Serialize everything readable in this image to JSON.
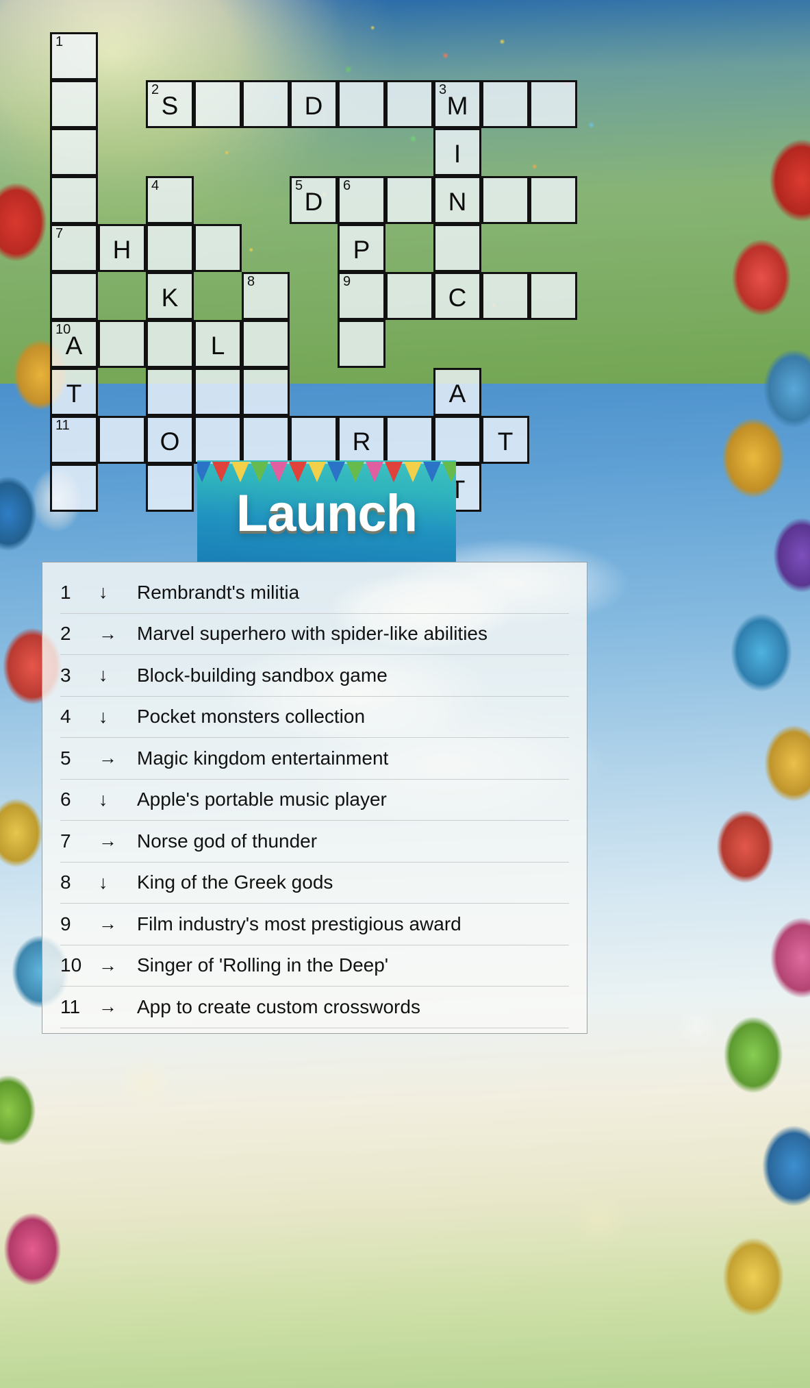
{
  "banner": {
    "title": "Launch"
  },
  "grid": {
    "columns": 12,
    "rows": 10,
    "cell_size": 70,
    "cells": [
      {
        "r": 0,
        "c": 0,
        "num": "1",
        "letter": ""
      },
      {
        "r": 1,
        "c": 0,
        "num": "",
        "letter": ""
      },
      {
        "r": 1,
        "c": 2,
        "num": "2",
        "letter": "S"
      },
      {
        "r": 1,
        "c": 3,
        "num": "",
        "letter": ""
      },
      {
        "r": 1,
        "c": 4,
        "num": "",
        "letter": ""
      },
      {
        "r": 1,
        "c": 5,
        "num": "",
        "letter": "D"
      },
      {
        "r": 1,
        "c": 6,
        "num": "",
        "letter": ""
      },
      {
        "r": 1,
        "c": 7,
        "num": "",
        "letter": ""
      },
      {
        "r": 1,
        "c": 8,
        "num": "3",
        "letter": "M"
      },
      {
        "r": 1,
        "c": 9,
        "num": "",
        "letter": ""
      },
      {
        "r": 1,
        "c": 10,
        "num": "",
        "letter": ""
      },
      {
        "r": 2,
        "c": 0,
        "num": "",
        "letter": ""
      },
      {
        "r": 2,
        "c": 8,
        "num": "",
        "letter": "I"
      },
      {
        "r": 3,
        "c": 0,
        "num": "",
        "letter": ""
      },
      {
        "r": 3,
        "c": 2,
        "num": "4",
        "letter": ""
      },
      {
        "r": 3,
        "c": 5,
        "num": "5",
        "letter": "D"
      },
      {
        "r": 3,
        "c": 6,
        "num": "6",
        "letter": ""
      },
      {
        "r": 3,
        "c": 7,
        "num": "",
        "letter": ""
      },
      {
        "r": 3,
        "c": 8,
        "num": "",
        "letter": "N"
      },
      {
        "r": 3,
        "c": 9,
        "num": "",
        "letter": ""
      },
      {
        "r": 3,
        "c": 10,
        "num": "",
        "letter": ""
      },
      {
        "r": 4,
        "c": 0,
        "num": "7",
        "letter": ""
      },
      {
        "r": 4,
        "c": 1,
        "num": "",
        "letter": "H"
      },
      {
        "r": 4,
        "c": 2,
        "num": "",
        "letter": ""
      },
      {
        "r": 4,
        "c": 3,
        "num": "",
        "letter": ""
      },
      {
        "r": 4,
        "c": 6,
        "num": "",
        "letter": "P"
      },
      {
        "r": 4,
        "c": 8,
        "num": "",
        "letter": ""
      },
      {
        "r": 5,
        "c": 0,
        "num": "",
        "letter": ""
      },
      {
        "r": 5,
        "c": 2,
        "num": "",
        "letter": "K"
      },
      {
        "r": 5,
        "c": 4,
        "num": "8",
        "letter": ""
      },
      {
        "r": 5,
        "c": 6,
        "num": "9",
        "letter": ""
      },
      {
        "r": 5,
        "c": 7,
        "num": "",
        "letter": ""
      },
      {
        "r": 5,
        "c": 8,
        "num": "",
        "letter": "C"
      },
      {
        "r": 5,
        "c": 9,
        "num": "",
        "letter": ""
      },
      {
        "r": 5,
        "c": 10,
        "num": "",
        "letter": ""
      },
      {
        "r": 6,
        "c": 0,
        "num": "10",
        "letter": "A"
      },
      {
        "r": 6,
        "c": 1,
        "num": "",
        "letter": ""
      },
      {
        "r": 6,
        "c": 2,
        "num": "",
        "letter": ""
      },
      {
        "r": 6,
        "c": 3,
        "num": "",
        "letter": "L"
      },
      {
        "r": 6,
        "c": 4,
        "num": "",
        "letter": ""
      },
      {
        "r": 6,
        "c": 6,
        "num": "",
        "letter": ""
      },
      {
        "r": 7,
        "c": 0,
        "num": "",
        "letter": "T"
      },
      {
        "r": 7,
        "c": 2,
        "num": "",
        "letter": ""
      },
      {
        "r": 7,
        "c": 3,
        "num": "",
        "letter": ""
      },
      {
        "r": 7,
        "c": 4,
        "num": "",
        "letter": ""
      },
      {
        "r": 7,
        "c": 8,
        "num": "",
        "letter": "A"
      },
      {
        "r": 8,
        "c": 0,
        "num": "11",
        "letter": ""
      },
      {
        "r": 8,
        "c": 1,
        "num": "",
        "letter": ""
      },
      {
        "r": 8,
        "c": 2,
        "num": "",
        "letter": "O"
      },
      {
        "r": 8,
        "c": 3,
        "num": "",
        "letter": ""
      },
      {
        "r": 8,
        "c": 4,
        "num": "",
        "letter": ""
      },
      {
        "r": 8,
        "c": 5,
        "num": "",
        "letter": ""
      },
      {
        "r": 8,
        "c": 6,
        "num": "",
        "letter": "R"
      },
      {
        "r": 8,
        "c": 7,
        "num": "",
        "letter": ""
      },
      {
        "r": 8,
        "c": 8,
        "num": "",
        "letter": ""
      },
      {
        "r": 8,
        "c": 9,
        "num": "",
        "letter": "T"
      },
      {
        "r": 9,
        "c": 0,
        "num": "",
        "letter": ""
      },
      {
        "r": 9,
        "c": 2,
        "num": "",
        "letter": ""
      },
      {
        "r": 9,
        "c": 8,
        "num": "",
        "letter": "T"
      }
    ]
  },
  "clues": [
    {
      "num": "1",
      "dir": "↓",
      "text": "Rembrandt's militia"
    },
    {
      "num": "2",
      "dir": "→",
      "text": "Marvel superhero with spider-like abilities"
    },
    {
      "num": "3",
      "dir": "↓",
      "text": "Block-building sandbox game"
    },
    {
      "num": "4",
      "dir": "↓",
      "text": "Pocket monsters collection"
    },
    {
      "num": "5",
      "dir": "→",
      "text": "Magic kingdom entertainment"
    },
    {
      "num": "6",
      "dir": "↓",
      "text": "Apple's portable music player"
    },
    {
      "num": "7",
      "dir": "→",
      "text": "Norse god of thunder"
    },
    {
      "num": "8",
      "dir": "↓",
      "text": "King of the Greek gods"
    },
    {
      "num": "9",
      "dir": "→",
      "text": "Film industry's most prestigious award"
    },
    {
      "num": "10",
      "dir": "→",
      "text": "Singer of 'Rolling in the Deep'"
    },
    {
      "num": "11",
      "dir": "→",
      "text": "App to create custom crosswords"
    }
  ],
  "colors": {
    "cell_fill": "#f0f5fb",
    "cell_border": "#111111",
    "banner_teal": "#2fb3bd",
    "panel_bg": "#fafaf6"
  }
}
